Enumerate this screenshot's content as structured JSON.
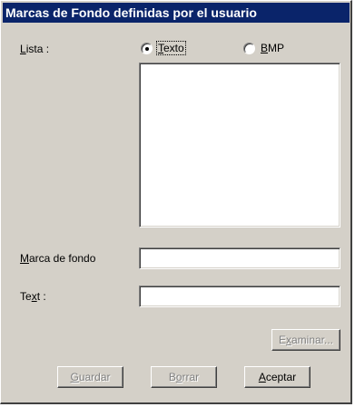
{
  "window": {
    "title": "Marcas de Fondo definidas por el usuario"
  },
  "lista": {
    "label_prefix": "",
    "label_access": "L",
    "label_rest": "ista :",
    "radio_texto": {
      "access": "T",
      "rest": "exto",
      "checked": true
    },
    "radio_bmp": {
      "access": "B",
      "rest": "MP",
      "checked": false
    },
    "items": []
  },
  "marca": {
    "label_access": "M",
    "label_rest": "arca de fondo",
    "value": ""
  },
  "text": {
    "label_pre": "Te",
    "label_access": "x",
    "label_post": "t :",
    "value": ""
  },
  "buttons": {
    "examinar": {
      "access": "x",
      "pre": "E",
      "post": "aminar...",
      "enabled": false
    },
    "guardar": {
      "access": "G",
      "rest": "uardar",
      "enabled": false
    },
    "borrar": {
      "access": "o",
      "pre": "B",
      "post": "rrar",
      "enabled": false
    },
    "aceptar": {
      "access": "A",
      "rest": "ceptar",
      "enabled": true
    }
  },
  "colors": {
    "titlebar": "#0a246a",
    "face": "#d4d0c8"
  }
}
